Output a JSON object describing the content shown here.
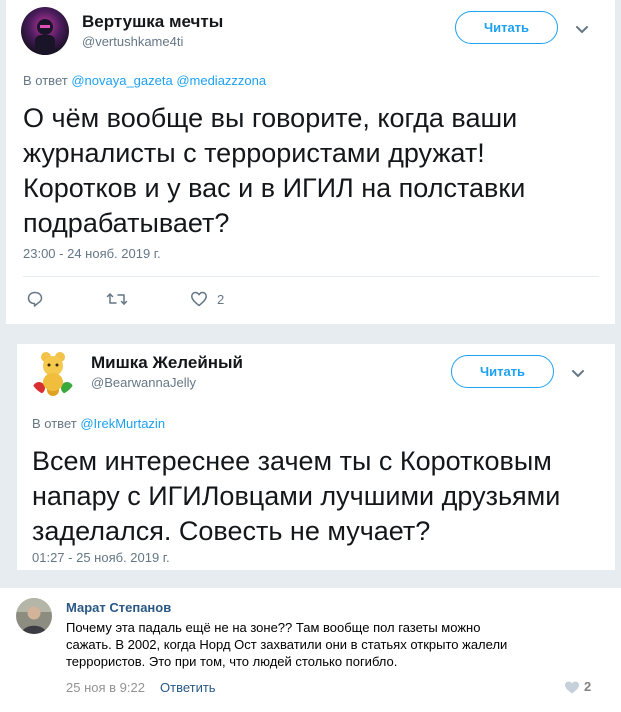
{
  "tweet1": {
    "name": "Вертушка мечты",
    "handle": "@vertushkame4ti",
    "follow_label": "Читать",
    "reply_prefix": "В ответ",
    "mentions": "@novaya_gazeta @mediazzzona",
    "text": "О чём вообще вы говорите, когда ваши\nжурналисты с террористами дружат!\nКоротков и у вас и в ИГИЛ на полставки\nподрабатывает?",
    "timestamp": "23:00 - 24 нояб. 2019 г.",
    "likes": "2"
  },
  "tweet2": {
    "name": "Мишка Желейный",
    "handle": "@BearwannaJelly",
    "follow_label": "Читать",
    "reply_prefix": "В ответ",
    "mentions": "@IrekMurtazin",
    "text": "Всем интереснее зачем ты с Коротковым\nнапару с ИГИЛовцами лучшими друзьями\nзаделался. Совесть не мучает?",
    "timestamp": "01:27 - 25 нояб. 2019 г."
  },
  "comment": {
    "name": "Марат Степанов",
    "text": "Почему эта падаль ещё не на зоне?? Там вообще пол газеты можно\nсажать. В 2002, когда Норд Ост захватили они в статьях открыто жалели\nтеррористов. Это при том, что людей столько погибло.",
    "date": "25 ноя в 9:22",
    "reply_label": "Ответить",
    "likes": "2"
  },
  "colors": {
    "accent": "#1da1f2",
    "vk_link": "#2a5885",
    "muted": "#657786",
    "background": "#e6ecf0"
  }
}
